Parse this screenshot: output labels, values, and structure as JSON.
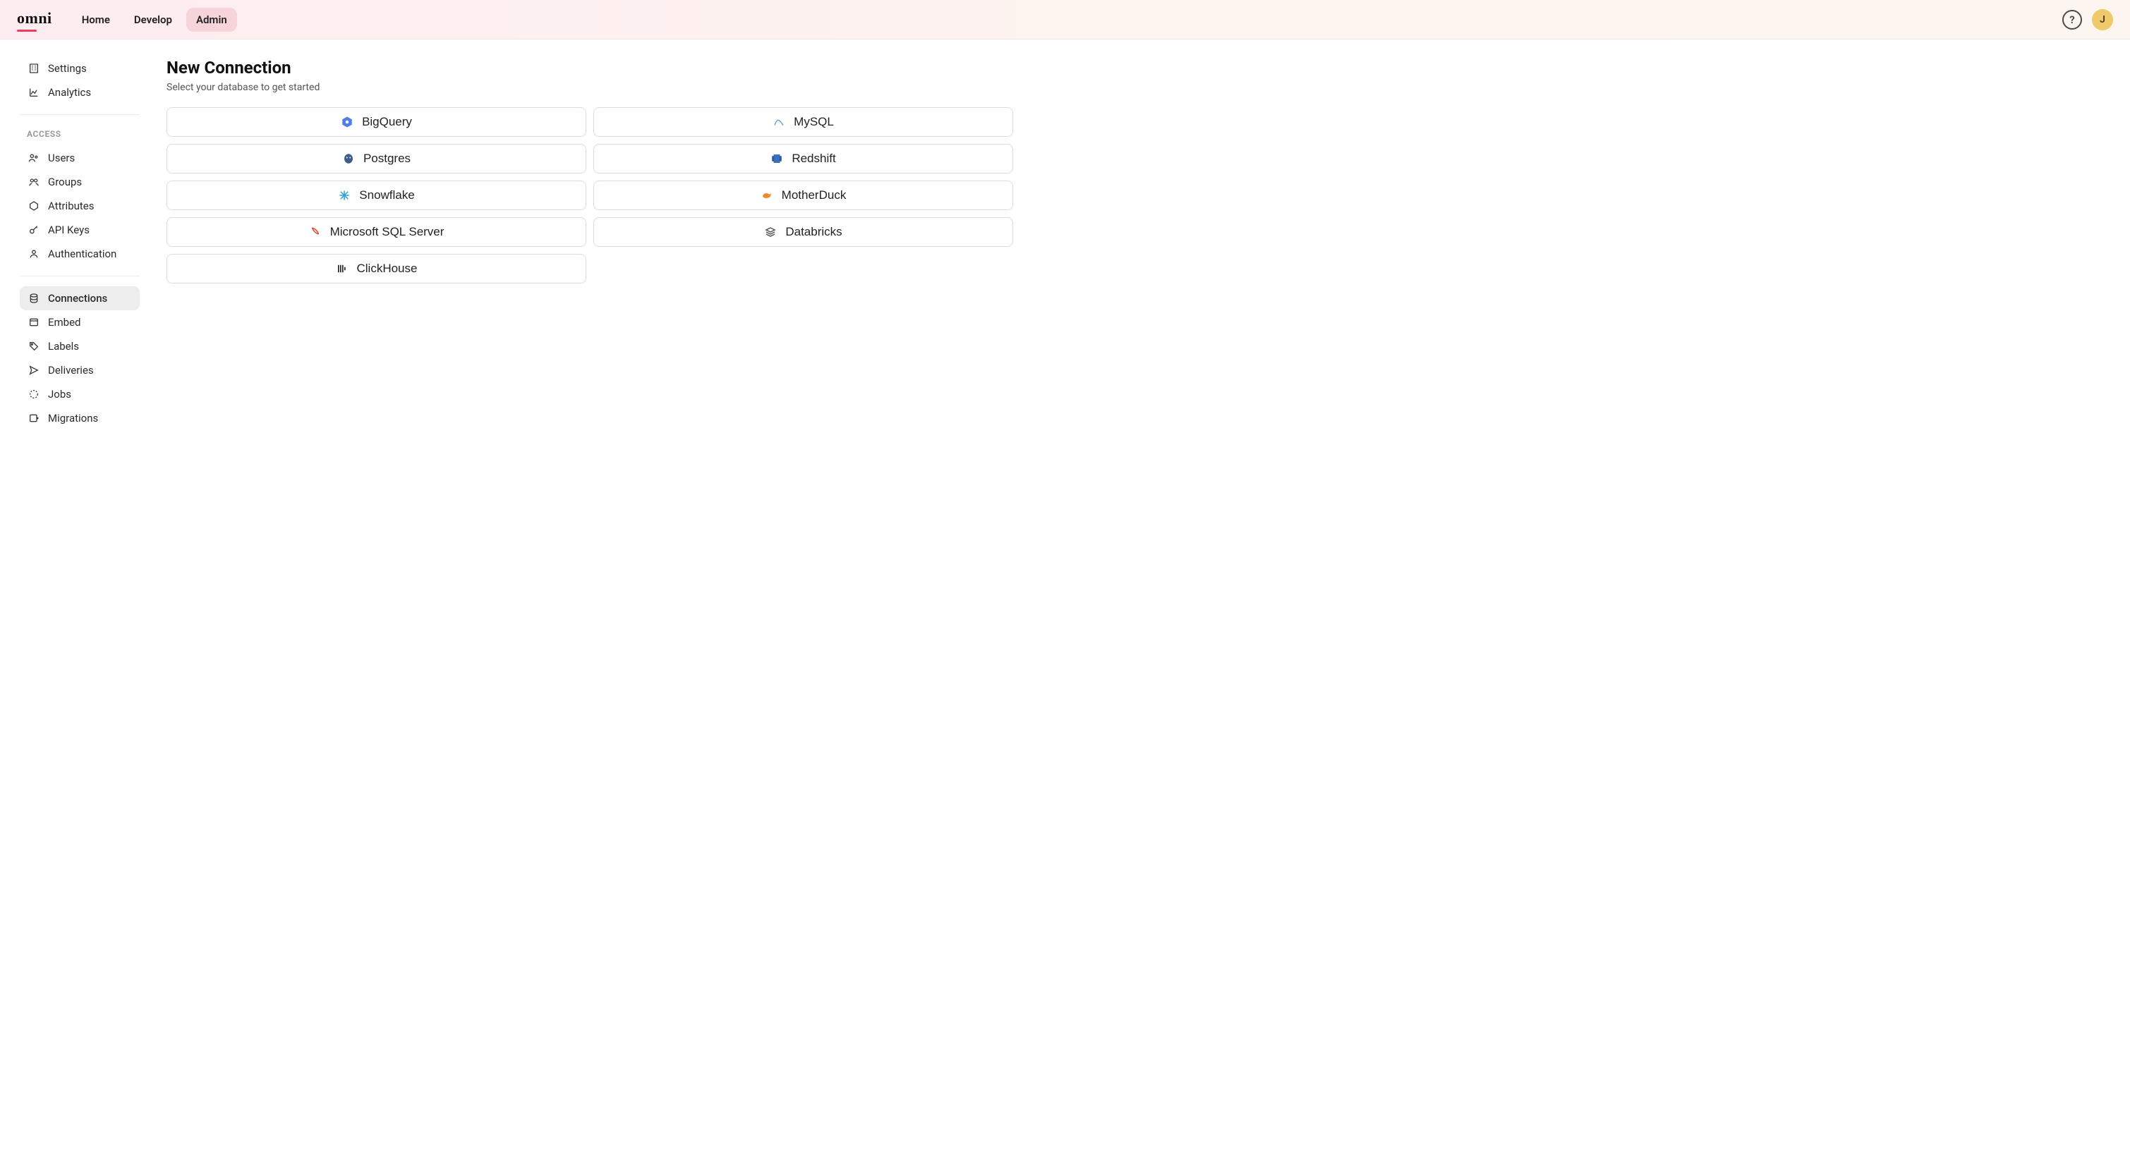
{
  "header": {
    "brand": "omni",
    "nav": [
      {
        "label": "Home",
        "active": false
      },
      {
        "label": "Develop",
        "active": false
      },
      {
        "label": "Admin",
        "active": true
      }
    ],
    "avatar_initial": "J"
  },
  "sidebar": {
    "top": [
      {
        "icon": "settings-company-icon",
        "label": "Settings"
      },
      {
        "icon": "analytics-icon",
        "label": "Analytics"
      }
    ],
    "access_heading": "ACCESS",
    "access": [
      {
        "icon": "users-icon",
        "label": "Users"
      },
      {
        "icon": "groups-icon",
        "label": "Groups"
      },
      {
        "icon": "attributes-icon",
        "label": "Attributes"
      },
      {
        "icon": "key-icon",
        "label": "API Keys"
      },
      {
        "icon": "auth-icon",
        "label": "Authentication"
      }
    ],
    "bottom": [
      {
        "icon": "database-icon",
        "label": "Connections",
        "active": true
      },
      {
        "icon": "embed-icon",
        "label": "Embed"
      },
      {
        "icon": "tag-icon",
        "label": "Labels"
      },
      {
        "icon": "send-icon",
        "label": "Deliveries"
      },
      {
        "icon": "jobs-icon",
        "label": "Jobs"
      },
      {
        "icon": "migrate-icon",
        "label": "Migrations"
      }
    ]
  },
  "main": {
    "title": "New Connection",
    "subtitle": "Select your database to get started",
    "databases": [
      {
        "label": "BigQuery",
        "icon_color": "#4f7de9"
      },
      {
        "label": "MySQL",
        "icon_color": "#6aa7c7"
      },
      {
        "label": "Postgres",
        "icon_color": "#3d5e8c"
      },
      {
        "label": "Redshift",
        "icon_color": "#3b6fbf"
      },
      {
        "label": "Snowflake",
        "icon_color": "#2aa0d8"
      },
      {
        "label": "MotherDuck",
        "icon_color": "#f08a2a"
      },
      {
        "label": "Microsoft SQL Server",
        "icon_color": "#d94b3a"
      },
      {
        "label": "Databricks",
        "icon_color": "#555"
      },
      {
        "label": "ClickHouse",
        "icon_color": "#222"
      }
    ]
  }
}
